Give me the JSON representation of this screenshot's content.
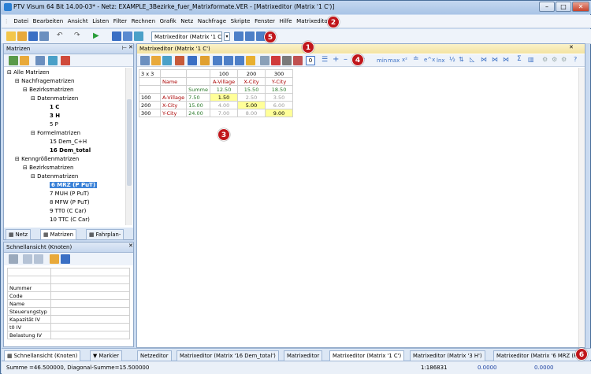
{
  "window": {
    "title": "PTV Visum 64 Bit 14.00-03* - Netz: EXAMPLE_3Bezirke_fuer_Matrixformate.VER - [Matrixeditor (Matrix '1 C')]"
  },
  "menu": [
    "Datei",
    "Bearbeiten",
    "Ansicht",
    "Listen",
    "Filter",
    "Rechnen",
    "Grafik",
    "Netz",
    "Nachfrage",
    "Skripte",
    "Fenster",
    "Hilfe",
    "Matrixeditor"
  ],
  "toolbar": {
    "matrix_combo": "Matrixeditor (Matrix '1 C')"
  },
  "matrices_panel": {
    "title": "Matrizen",
    "tree": [
      {
        "label": "Alle Matrizen",
        "level": 0
      },
      {
        "label": "Nachfragematrizen",
        "level": 1
      },
      {
        "label": "Bezirksmatrizen",
        "level": 2
      },
      {
        "label": "Datenmatrizen",
        "level": 3
      },
      {
        "label": "1 C",
        "level": 4,
        "bold": true
      },
      {
        "label": "3 H",
        "level": 4,
        "bold": true
      },
      {
        "label": "5 P",
        "level": 4
      },
      {
        "label": "Formelmatrizen",
        "level": 3
      },
      {
        "label": "15 Dem_C+H",
        "level": 4
      },
      {
        "label": "16 Dem_total",
        "level": 4,
        "bold": true
      },
      {
        "label": "Kenngrößenmatrizen",
        "level": 1
      },
      {
        "label": "Bezirksmatrizen",
        "level": 2
      },
      {
        "label": "Datenmatrizen",
        "level": 3
      },
      {
        "label": "6 MRZ (P PuT)",
        "level": 4,
        "selected": true
      },
      {
        "label": "7 MUH (P PuT)",
        "level": 4
      },
      {
        "label": "8 MFW (P PuT)",
        "level": 4
      },
      {
        "label": "9 TT0 (C Car)",
        "level": 4
      },
      {
        "label": "10 TTC (C Car)",
        "level": 4
      }
    ],
    "tabs": [
      "Netz",
      "Matrizen",
      "Fahrplan-"
    ]
  },
  "quickview_panel": {
    "title": "Schnellansicht (Knoten)",
    "rows": [
      "Nummer",
      "Code",
      "Name",
      "Steuerungstyp",
      "Kapazität IV",
      "t0 IV",
      "Belastung IV"
    ]
  },
  "editor": {
    "title": "Matrixeditor (Matrix '1 C')",
    "dims": "3 x 3",
    "col_header_name": "Name",
    "col_ids": [
      "100",
      "200",
      "300"
    ],
    "col_names": [
      "A-Village",
      "X-City",
      "Y-City"
    ],
    "sum_label": "Summe",
    "col_sums": [
      "12.50",
      "15.50",
      "18.50"
    ],
    "rows": [
      {
        "id": "100",
        "name": "A-Village",
        "sum": "7.50",
        "cells": [
          "1.50",
          "2.50",
          "3.50"
        ]
      },
      {
        "id": "200",
        "name": "X-City",
        "sum": "15.00",
        "cells": [
          "4.00",
          "5.00",
          "6.00"
        ]
      },
      {
        "id": "300",
        "name": "Y-City",
        "sum": "24.00",
        "cells": [
          "7.00",
          "8.00",
          "9.00"
        ]
      }
    ],
    "toolbar_text": [
      "min",
      "max",
      "x²",
      "e^x",
      "lnx"
    ]
  },
  "bottom_tabs_left": [
    "Schnellansicht (Knoten)",
    "Markier"
  ],
  "bottom_tabs": [
    "Netzeditor",
    "Matrixeditor (Matrix '16 Dem_total')",
    "Matrixeditor",
    "Matrixeditor (Matrix '1 C')",
    "Matrixeditor (Matrix '3 H')",
    "Matrixeditor (Matrix '6 MRZ (P"
  ],
  "status": {
    "sum": "Summe =46.500000, Diagonal-Summe=15.500000",
    "scale": "1:186831",
    "x": "0.0000",
    "y": "0.0000"
  },
  "callouts": [
    "1",
    "2",
    "3",
    "4",
    "5",
    "6"
  ],
  "colors": {
    "selected": "#3b82d8",
    "diag_yellow": "#ffff99",
    "callout_red": "#c0161b"
  }
}
